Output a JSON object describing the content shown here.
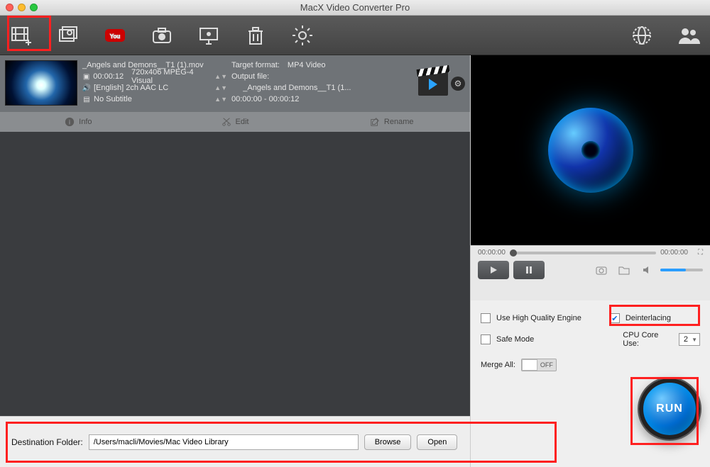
{
  "window": {
    "title": "MacX Video Converter Pro"
  },
  "toolbar": {
    "items": [
      {
        "name": "add-video-icon"
      },
      {
        "name": "add-photo-icon"
      },
      {
        "name": "youtube-icon"
      },
      {
        "name": "record-camera-icon"
      },
      {
        "name": "record-screen-icon"
      },
      {
        "name": "trash-icon"
      },
      {
        "name": "settings-gear-icon"
      },
      {
        "name": "web-globe-icon"
      },
      {
        "name": "people-icon"
      }
    ]
  },
  "file": {
    "name": "_Angels and Demons__T1 (1).mov",
    "duration": "00:00:12",
    "video_spec": "720x406 MPEG-4 Visual",
    "audio_spec": "[English] 2ch AAC LC",
    "subtitle": "No Subtitle",
    "target_format_label": "Target format:",
    "target_format": "MP4 Video",
    "output_file_label": "Output file:",
    "output_file": "_Angels and Demons__T1 (1...",
    "range": "00:00:00 - 00:00:12"
  },
  "actions": {
    "info": "Info",
    "edit": "Edit",
    "rename": "Rename"
  },
  "destination": {
    "label": "Destination Folder:",
    "path": "/Users/macli/Movies/Mac Video Library",
    "browse": "Browse",
    "open": "Open"
  },
  "preview": {
    "time_start": "00:00:00",
    "time_end": "00:00:00"
  },
  "options": {
    "hq_label": "Use High Quality Engine",
    "hq_checked": false,
    "deint_label": "Deinterlacing",
    "deint_checked": true,
    "safe_label": "Safe Mode",
    "safe_checked": false,
    "cpu_label": "CPU Core Use:",
    "cpu_value": "2",
    "merge_label": "Merge All:",
    "merge_state": "OFF",
    "run_label": "RUN"
  }
}
